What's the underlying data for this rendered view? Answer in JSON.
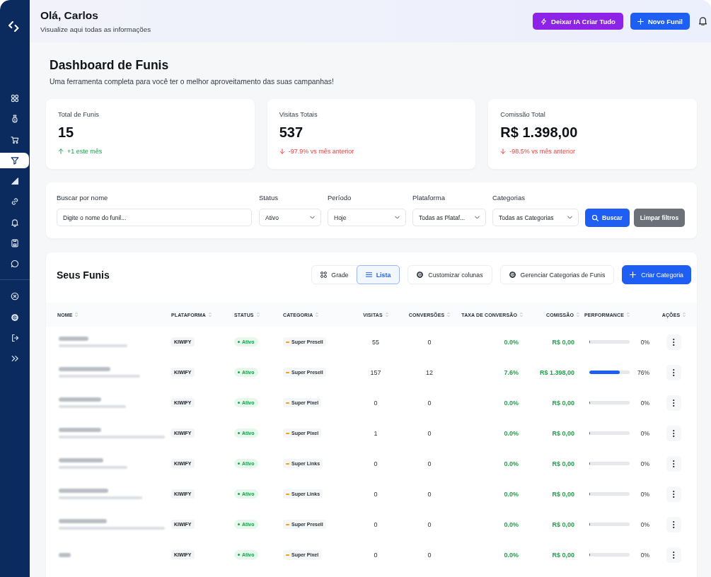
{
  "sidebar": {
    "items": [
      {
        "selected": false
      },
      {
        "selected": false
      },
      {
        "selected": false
      },
      {
        "selected": true
      },
      {
        "selected": false
      },
      {
        "selected": false
      },
      {
        "selected": false
      },
      {
        "selected": false
      },
      {
        "selected": false
      }
    ]
  },
  "header": {
    "greeting": "Olá, Carlos",
    "subtitle": "Visualize aqui todas as informações",
    "buttons": [
      {
        "label": "Deixar IA Criar Tudo",
        "kind": "ai"
      },
      {
        "label": "Novo Funil",
        "kind": "primary"
      }
    ]
  },
  "page": {
    "title": "Dashboard de Funis",
    "subtitle": "Uma ferramenta completa para você ter o melhor aproveitamento das suas campanhas!"
  },
  "stats": [
    {
      "label": "Total de Funis",
      "value": "15",
      "change": "+1 este mês",
      "increase": true
    },
    {
      "label": "Visitas Totais",
      "value": "537",
      "change": "-97.9% vs mês anterior",
      "increase": false
    },
    {
      "label": "Comissão Total",
      "value": "R$ 1.398,00",
      "change": "-98.5% vs mês anterior",
      "increase": false
    }
  ],
  "filters": {
    "search": {
      "label": "Buscar por nome",
      "placeholder": "Digite o nome do funil..."
    },
    "selects": [
      {
        "label": "Status",
        "value": "Ativo"
      },
      {
        "label": "Período",
        "value": "Hoje"
      },
      {
        "label": "Plataforma",
        "value": "Todas as Plataf..."
      },
      {
        "label": "Categorias",
        "value": "Todas as Categorias"
      }
    ],
    "search_button": "Buscar",
    "clear_button": "Limpar filtros"
  },
  "table": {
    "title": "Seus Funis",
    "views": [
      {
        "label": "Grade",
        "selected": false
      },
      {
        "label": "Lista",
        "selected": true
      }
    ],
    "buttons": [
      {
        "label": "Customizar colunas",
        "kind": "settings"
      },
      {
        "label": "Gerenciar Categorias de Funis",
        "kind": "settings"
      },
      {
        "label": "Criar Categoria",
        "kind": "primary"
      }
    ],
    "columns": [
      "NOME",
      "PLATAFORMA",
      "STATUS",
      "CATEGORIA",
      "VISITAS",
      "CONVERSÕES",
      "TAXA DE CONVERSÃO",
      "COMISSÃO",
      "PERFORMANCE",
      "AÇÕES"
    ],
    "rows": [
      {
        "platform": "KIWIFY",
        "status": "Ativo",
        "category": "Super Presell",
        "visits": "55",
        "conversions": "0",
        "conversion_rate": "0.0%",
        "commission": "R$ 0,00",
        "performance": {
          "level": 0,
          "label": "0%"
        }
      },
      {
        "platform": "KIWIFY",
        "status": "Ativo",
        "category": "Super Presell",
        "visits": "157",
        "conversions": "12",
        "conversion_rate": "7.6%",
        "commission": "R$ 1.398,00",
        "performance": {
          "level": 0.76,
          "label": "76%"
        }
      },
      {
        "platform": "KIWIFY",
        "status": "Ativo",
        "category": "Super Pixel",
        "visits": "0",
        "conversions": "0",
        "conversion_rate": "0.0%",
        "commission": "R$ 0,00",
        "performance": {
          "level": 0,
          "label": "0%"
        }
      },
      {
        "platform": "KIWIFY",
        "status": "Ativo",
        "category": "Super Pixel",
        "visits": "1",
        "conversions": "0",
        "conversion_rate": "0.0%",
        "commission": "R$ 0,00",
        "performance": {
          "level": 0,
          "label": "0%"
        }
      },
      {
        "platform": "KIWIFY",
        "status": "Ativo",
        "category": "Super Links",
        "visits": "0",
        "conversions": "0",
        "conversion_rate": "0.0%",
        "commission": "R$ 0,00",
        "performance": {
          "level": 0,
          "label": "0%"
        }
      },
      {
        "platform": "KIWIFY",
        "status": "Ativo",
        "category": "Super Links",
        "visits": "0",
        "conversions": "0",
        "conversion_rate": "0.0%",
        "commission": "R$ 0,00",
        "performance": {
          "level": 0,
          "label": "0%"
        }
      },
      {
        "platform": "KIWIFY",
        "status": "Ativo",
        "category": "Super Presell",
        "visits": "0",
        "conversions": "0",
        "conversion_rate": "0.0%",
        "commission": "R$ 0,00",
        "performance": {
          "level": 0,
          "label": "0%"
        }
      },
      {
        "platform": "KIWIFY",
        "status": "Ativo",
        "category": "Super Pixel",
        "visits": "0",
        "conversions": "0",
        "conversion_rate": "0.0%",
        "commission": "R$ 0,00",
        "performance": {
          "level": 0,
          "label": "0%"
        }
      }
    ]
  }
}
